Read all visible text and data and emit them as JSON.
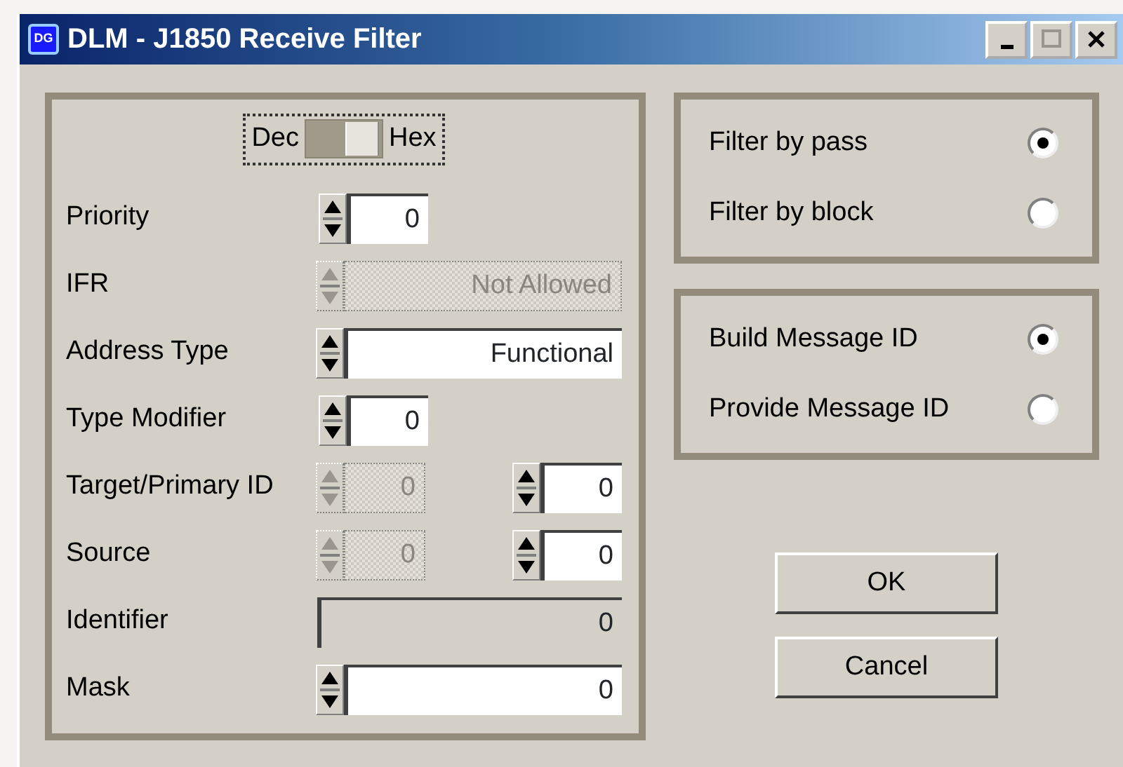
{
  "window": {
    "title": "DLM - J1850 Receive Filter",
    "app_badge": "DG"
  },
  "base_toggle": {
    "left": "Dec",
    "right": "Hex",
    "hex": true
  },
  "fields": [
    {
      "label": "Priority",
      "kind": "short",
      "values": [
        "0"
      ],
      "disabled": false
    },
    {
      "label": "IFR",
      "kind": "long",
      "values": [
        "Not Allowed"
      ],
      "disabled": true
    },
    {
      "label": "Address Type",
      "kind": "long",
      "values": [
        "Functional"
      ],
      "disabled": false
    },
    {
      "label": "Type Modifier",
      "kind": "short",
      "values": [
        "0"
      ],
      "disabled": false
    },
    {
      "label": "Target/Primary ID",
      "kind": "pair",
      "values": [
        "0",
        "0"
      ],
      "disabled": true
    },
    {
      "label": "Source",
      "kind": "pair",
      "values": [
        "0",
        "0"
      ],
      "disabled": true
    },
    {
      "label": "Identifier",
      "kind": "readout",
      "values": [
        "0"
      ],
      "disabled": false
    },
    {
      "label": "Mask",
      "kind": "long",
      "values": [
        "0"
      ],
      "disabled": false
    }
  ],
  "radio_groups": [
    [
      {
        "label": "Filter by pass",
        "selected": true
      },
      {
        "label": "Filter by block",
        "selected": false
      }
    ],
    [
      {
        "label": "Build Message ID",
        "selected": true
      },
      {
        "label": "Provide Message ID",
        "selected": false
      }
    ]
  ],
  "buttons": [
    "OK",
    "Cancel"
  ]
}
